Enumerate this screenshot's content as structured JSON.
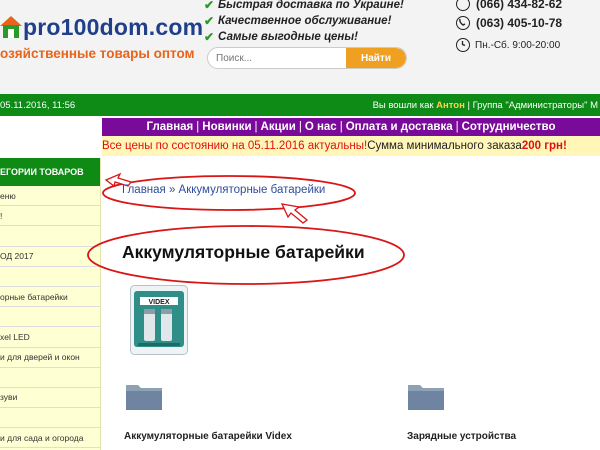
{
  "header": {
    "logo_text": "pro100dom.com",
    "tagline": "озяйственные товары оптом",
    "features": [
      "Быстрая доставка по Украине!",
      "Качественное обслуживание!",
      "Самые выгодные цены!"
    ],
    "search": {
      "placeholder": "Поиск...",
      "button": "Найти"
    },
    "phones": [
      "(066) 434-82-62",
      "(063) 405-10-78"
    ],
    "hours": "Пн.-Сб. 9:00-20:00"
  },
  "status_bar": {
    "date": "05.11.2016, 11:56",
    "login_prefix": "Вы вошли как",
    "user": "Антон",
    "group_text": "| Группа \"Администраторы\" М"
  },
  "nav": {
    "items": [
      "Главная",
      "Новинки",
      "Акции",
      "О нас",
      "Оплата и доставка",
      "Сотрудничество"
    ]
  },
  "notice": {
    "part1": "Все цены по состоянию на 05.11.2016 актуальны!",
    "part2": " Сумма минимального заказа ",
    "amount": "200 грн!"
  },
  "sidebar": {
    "title": "ЕГОРИИ ТОВАРОВ",
    "items": [
      "еню",
      "!",
      "",
      "ОД 2017",
      "",
      "орные батарейки",
      "",
      "xel LED",
      "и для дверей и окон",
      "",
      "зуви",
      "",
      "и для сада и огорода",
      ""
    ]
  },
  "main": {
    "breadcrumb": "Главная » Аккумуляторные батарейки",
    "title": "Аккумуляторные батарейки",
    "product_brand": "VIDEX",
    "categories": [
      {
        "label": "Аккумуляторные батарейки Videx"
      },
      {
        "label": "Зарядные устройства"
      }
    ]
  },
  "colors": {
    "green": "#0e8a17",
    "purple": "#7a0a9a",
    "annotation_red": "#d91515",
    "notice_bg": "#fff6b8",
    "link_blue": "#2f4d9a"
  }
}
